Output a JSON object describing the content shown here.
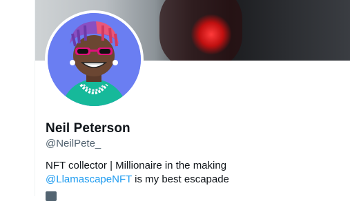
{
  "profile": {
    "name": "Neil Peterson",
    "handle": "@NeilPete_",
    "bio_text": "NFT collector | Millionaire in the making",
    "bio_mention": "@LlamascapeNFT",
    "bio_suffix": " is my best escapade"
  },
  "colors": {
    "avatar_bg": "#6a7ef2",
    "link": "#1d9bf0",
    "handle": "#536471"
  },
  "icons": {
    "meta": "calendar-icon"
  }
}
